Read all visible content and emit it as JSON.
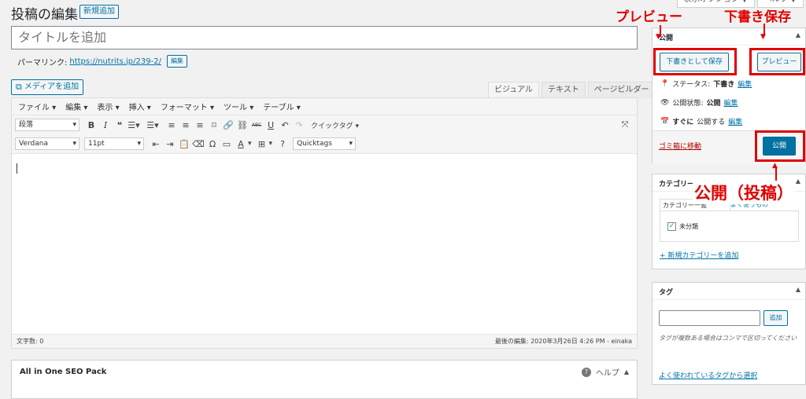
{
  "header": {
    "title": "投稿の編集",
    "add_new": "新規追加",
    "screen_options": "表示オプション ▼",
    "help": "ヘルプ ▼"
  },
  "title_input": {
    "placeholder": "タイトルを追加"
  },
  "permalink": {
    "label": "パーマリンク:",
    "url": "https://nutrits.jp/239-2/",
    "edit": "編集"
  },
  "media_button": "メディアを追加",
  "editor_tabs": [
    "ビジュアル",
    "テキスト",
    "ページビルダー"
  ],
  "menubar": [
    "ファイル ▾",
    "編集 ▾",
    "表示 ▾",
    "挿入 ▾",
    "フォーマット ▾",
    "ツール ▾",
    "テーブル ▾"
  ],
  "toolbar1": {
    "format": "段落",
    "quicktag": "クイックタグ ▾"
  },
  "toolbar2": {
    "font": "Verdana",
    "size": "11pt",
    "quicktags": "Quicktags"
  },
  "statusbar": {
    "word_count": "文字数: 0",
    "last_edit": "最後の編集: 2020年3月26日 4:26 PM - einaka"
  },
  "seo": {
    "title": "All in One SEO Pack",
    "help": "ヘルプ"
  },
  "publish_box": {
    "title": "公開",
    "save_draft": "下書きとして保存",
    "preview": "プレビュー",
    "status_label": "ステータス:",
    "status_value": "下書き",
    "visibility_label": "公開状態:",
    "visibility_value": "公開",
    "schedule_label": "すぐに",
    "schedule_rest": "公開する",
    "edit": "編集",
    "trash": "ゴミ箱に移動",
    "publish": "公開"
  },
  "category_box": {
    "title": "カテゴリー",
    "tab_all": "カテゴリー一覧",
    "tab_popular": "よく使うもの",
    "items": [
      {
        "label": "未分類",
        "checked": true
      }
    ],
    "add_new": "+ 新規カテゴリーを追加"
  },
  "tag_box": {
    "title": "タグ",
    "add": "追加",
    "hint": "タグが複数ある場合はコンマで区切ってください",
    "popular": "よく使われているタグから選択"
  },
  "annotations": {
    "preview": "プレビュー",
    "draft_save": "下書き保存",
    "publish": "公開（投稿）",
    "color": "#e00000"
  }
}
